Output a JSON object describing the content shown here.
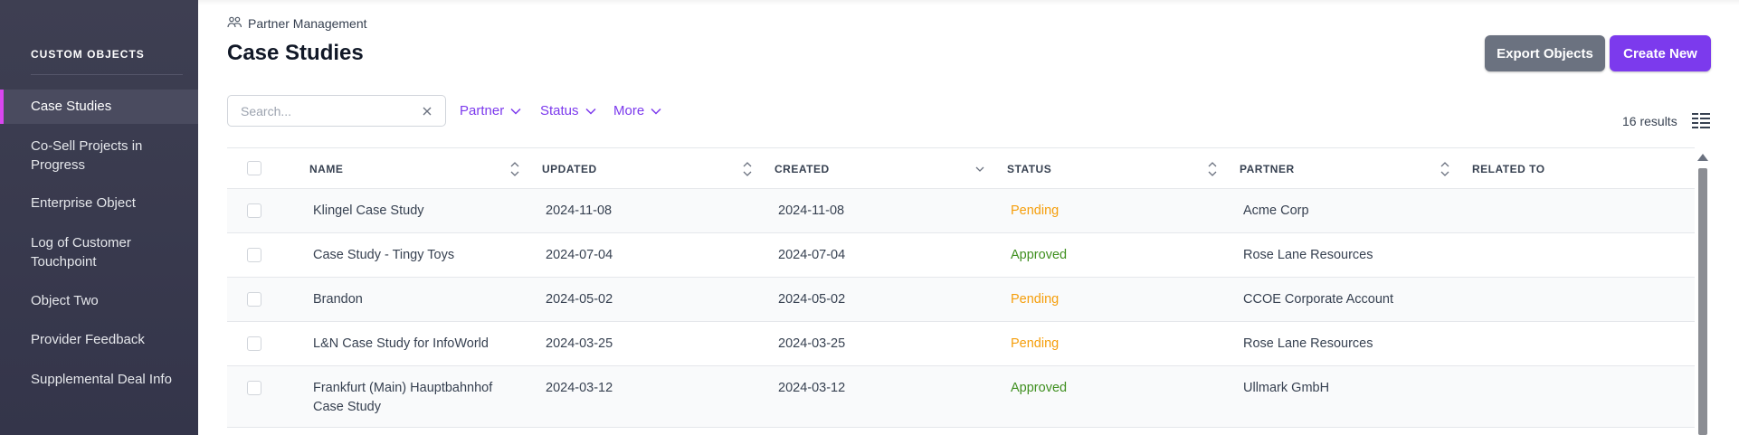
{
  "sidebar": {
    "heading": "CUSTOM OBJECTS",
    "accent_color": "#d946ef",
    "items": [
      {
        "label": "Case Studies",
        "active": true
      },
      {
        "label": "Co-Sell Projects in Progress",
        "active": false
      },
      {
        "label": "Enterprise Object",
        "active": false
      },
      {
        "label": "Log of Customer Touchpoint",
        "active": false
      },
      {
        "label": "Object Two",
        "active": false
      },
      {
        "label": "Provider Feedback",
        "active": false
      },
      {
        "label": "Supplemental Deal Info",
        "active": false
      }
    ]
  },
  "header": {
    "breadcrumb_icon": "people-icon",
    "breadcrumb": "Partner Management",
    "title": "Case Studies",
    "export_label": "Export Objects",
    "create_label": "Create New",
    "primary_color": "#7c3aed",
    "secondary_color": "#6b7280"
  },
  "toolbar": {
    "search_placeholder": "Search...",
    "search_value": "",
    "filters": [
      "Partner",
      "Status",
      "More"
    ],
    "results": "16 results"
  },
  "table": {
    "columns": [
      "NAME",
      "UPDATED",
      "CREATED",
      "STATUS",
      "PARTNER",
      "RELATED TO"
    ],
    "rows": [
      {
        "name": "Klingel Case Study",
        "updated": "2024-11-08",
        "created": "2024-11-08",
        "status": "Pending",
        "partner": "Acme Corp",
        "related": ""
      },
      {
        "name": "Case Study - Tingy Toys",
        "updated": "2024-07-04",
        "created": "2024-07-04",
        "status": "Approved",
        "partner": "Rose Lane Resources",
        "related": ""
      },
      {
        "name": "Brandon",
        "updated": "2024-05-02",
        "created": "2024-05-02",
        "status": "Pending",
        "partner": "CCOE Corporate Account",
        "related": ""
      },
      {
        "name": "L&N Case Study for InfoWorld",
        "updated": "2024-03-25",
        "created": "2024-03-25",
        "status": "Pending",
        "partner": "Rose Lane Resources",
        "related": ""
      },
      {
        "name": "Frankfurt (Main) Hauptbahnhof Case Study",
        "updated": "2024-03-12",
        "created": "2024-03-12",
        "status": "Approved",
        "partner": "Ullmark GmbH",
        "related": ""
      }
    ],
    "status_colors": {
      "Pending": "#f59e0b",
      "Approved": "#3f8f1f"
    }
  }
}
